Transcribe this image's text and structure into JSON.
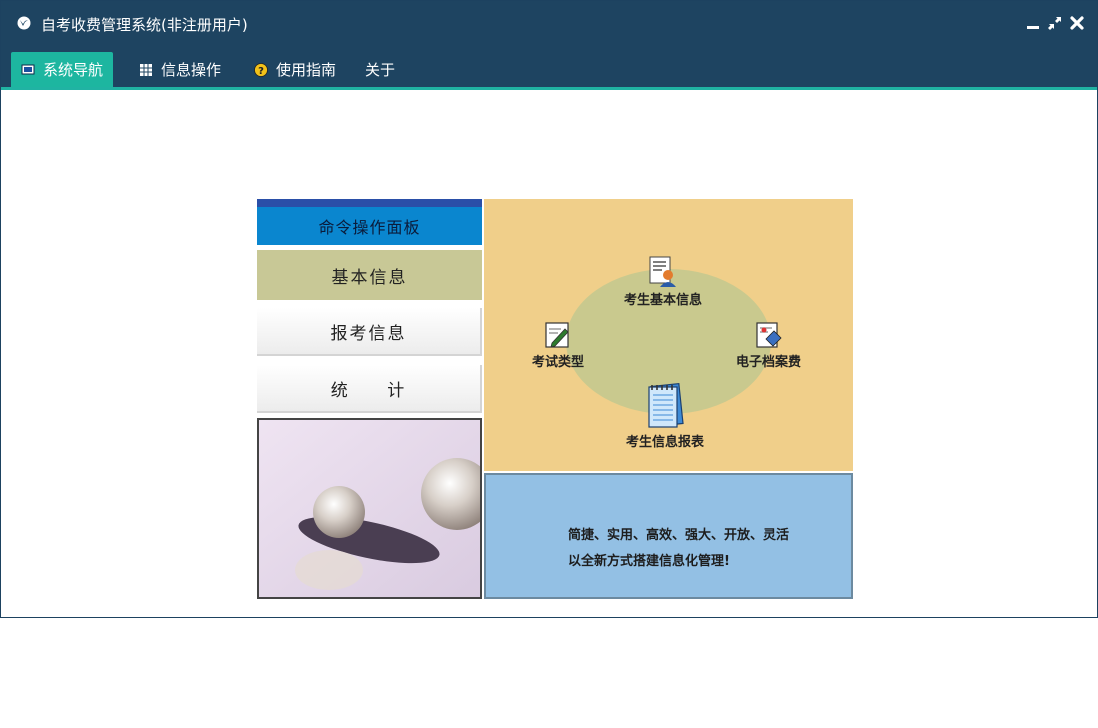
{
  "window": {
    "title": "自考收费管理系统(非注册用户)"
  },
  "menu": {
    "items": [
      {
        "label": "系统导航",
        "icon": "monitor-icon"
      },
      {
        "label": "信息操作",
        "icon": "grid-icon"
      },
      {
        "label": "使用指南",
        "icon": "help-icon"
      },
      {
        "label": "关于"
      }
    ]
  },
  "panel": {
    "header": "命令操作面板",
    "nav": {
      "basic": "基本信息",
      "apply": "报考信息",
      "stat": "统 计"
    },
    "features": {
      "student_info": "考生基本信息",
      "exam_type": "考试类型",
      "archive_fee": "电子档案费",
      "report": "考生信息报表"
    },
    "slogan": {
      "line1": "简捷、实用、高效、强大、开放、灵活",
      "line2": "以全新方式搭建信息化管理!"
    }
  },
  "colors": {
    "titlebar": "#1e4461",
    "accent": "#1db6a0",
    "header_blue": "#0a86cf",
    "basic_bg": "#c8c896",
    "orange_panel": "#f0cf8a",
    "blue_panel": "#93c0e4"
  }
}
